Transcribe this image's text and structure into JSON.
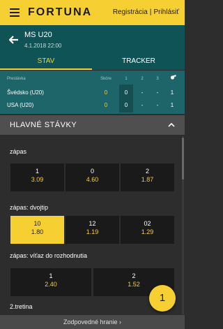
{
  "header": {
    "brand": "FORTUNA",
    "register": "Registrácia",
    "separator": "|",
    "login": "Prihlásiť"
  },
  "match": {
    "title": "MS U20",
    "date": "4.1.2018 22:00"
  },
  "tabs": [
    {
      "label": "STAV",
      "active": true
    },
    {
      "label": "TRACKER",
      "active": false
    }
  ],
  "score_table": {
    "headers": {
      "team": "Prestávka",
      "score": "Skóre",
      "p1": "1",
      "p2": "2",
      "p3": "3"
    },
    "rows": [
      {
        "team": "Švédsko (U20)",
        "score": "0",
        "p1": "0",
        "p2": "-",
        "p3": "-",
        "p4": "1"
      },
      {
        "team": "USA (U20)",
        "score": "0",
        "p1": "0",
        "p2": "-",
        "p3": "-",
        "p4": "1"
      }
    ]
  },
  "section": {
    "title": "HLAVNÉ STÁVKY"
  },
  "markets": [
    {
      "label": "zápas",
      "odds": [
        {
          "label": "1",
          "value": "3.09"
        },
        {
          "label": "0",
          "value": "4.60"
        },
        {
          "label": "2",
          "value": "1.87"
        }
      ]
    },
    {
      "label": "zápas: dvojtip",
      "odds": [
        {
          "label": "10",
          "value": "1.80",
          "selected": true
        },
        {
          "label": "12",
          "value": "1.19"
        },
        {
          "label": "02",
          "value": "1.29"
        }
      ]
    },
    {
      "label": "zápas: víťaz do rozhodnutia",
      "odds": [
        {
          "label": "1",
          "value": "2.40"
        },
        {
          "label": "2",
          "value": "1.52"
        }
      ]
    },
    {
      "label": "2.tretina"
    }
  ],
  "footer": {
    "text": "Zodpovedné hranie ›"
  },
  "betslip": {
    "count": "1"
  },
  "colors": {
    "accent": "#f6d033",
    "header_teal": "#0f5357",
    "table_teal": "#1d6569"
  }
}
